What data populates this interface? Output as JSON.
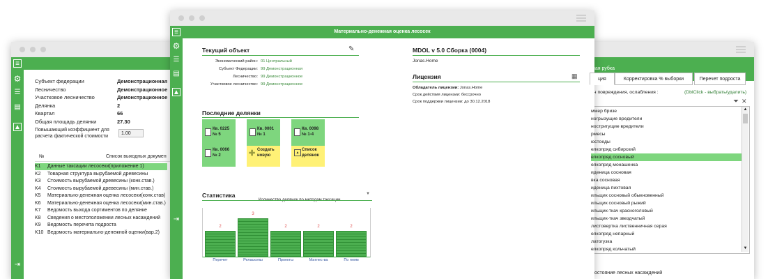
{
  "left_window": {
    "fields": [
      {
        "label": "Субъект федерации",
        "value": "Демонстрационная"
      },
      {
        "label": "Лесничество",
        "value": "Демонстрационное"
      },
      {
        "label": "Участковое лесничество",
        "value": "Демонстрационное"
      },
      {
        "label": "Делянка",
        "value": "2"
      },
      {
        "label": "Квартал",
        "value": "66"
      },
      {
        "label": "Общая площадь делянки",
        "value": "27.30"
      }
    ],
    "coef_label_1": "Повышающий коэффициент для",
    "coef_label_2": "расчета фактической стоимости",
    "coef_value": "1.00",
    "table_col_num": "№",
    "table_col_list": "Список выходных докумен",
    "docs": [
      {
        "code": "K1",
        "name": "Данные таксации лесосеки(приложение 1)"
      },
      {
        "code": "K2",
        "name": "Товарная структура вырубаемой древесины"
      },
      {
        "code": "K3",
        "name": "Стоимость вырубаемой древесины (конк.став.)"
      },
      {
        "code": "K4",
        "name": "Стоимость вырубаемой древесины (мин.став.)"
      },
      {
        "code": "K5",
        "name": "Материально-денежная оценка лесосеки(конк.став)"
      },
      {
        "code": "K6",
        "name": "Материально-денежная оценка лесосеки(мин.став.)"
      },
      {
        "code": "K7",
        "name": "Ведомость выхода сортиментов по делянке"
      },
      {
        "code": "K8",
        "name": "Сведения о местоположении лесных насаждений"
      },
      {
        "code": "K9",
        "name": "Ведомость перечета подроста"
      },
      {
        "code": "K10",
        "name": "Ведомость материально-денежной оценки(вар.2)"
      }
    ]
  },
  "center_window": {
    "title": "Материально-денежная оценка лесосек",
    "current_object": {
      "heading": "Текущий объект",
      "rows": [
        {
          "label": "Экономический район:",
          "value": "01 Центральный"
        },
        {
          "label": "Субъект Федерации:",
          "value": "99 Демонстрационная"
        },
        {
          "label": "Лесничество:",
          "value": "99 Демонстрационное"
        },
        {
          "label": "Участковое лесничество:",
          "value": "99 Демонстрационное"
        }
      ]
    },
    "version": {
      "heading": "MDOL v 5.0 Сборка (0004)",
      "owner": "Jonas.Home"
    },
    "license": {
      "heading": "Лицензия",
      "owner_label": "Обладатель лицензии:",
      "owner_value": "Jonas.Home",
      "term": "Срок действия лицензии: бессрочно",
      "support": "Срок поддержки лицензии: до 30.12.2018"
    },
    "recent": {
      "heading": "Последние делянки",
      "tiles": [
        {
          "line1": "Кв. 0225",
          "line2": "№ 5"
        },
        {
          "line1": "Кв. 0001",
          "line2": "№ 1"
        },
        {
          "line1": "Кв. 0098",
          "line2": "№ 1-4"
        },
        {
          "line1": "Кв. 0066",
          "line2": "№ 2"
        }
      ],
      "create_1": "Создать",
      "create_2": "новую",
      "list_1": "Список",
      "list_2": "делянок"
    },
    "stats": {
      "heading": "Статистика",
      "dropdown": "Количество делянок по методам таксации"
    }
  },
  "chart_data": {
    "type": "bar",
    "categories": [
      "Перечет",
      "Реласкопы",
      "Проекты",
      "Матлес-ва",
      "По пням"
    ],
    "values": [
      2,
      3,
      2,
      2,
      2
    ],
    "title": "",
    "xlabel": "",
    "ylabel": "",
    "ylim": [
      0,
      3
    ]
  },
  "right_window": {
    "title": "ная рубка",
    "tabs": [
      "ция",
      "Корректировка % выборки",
      "Перечет подроста"
    ],
    "filter_label": "ин повреждения, ослабления :",
    "filter_hint": "(DblClick - выбрать/удалить)",
    "items": [
      "ммер бризе",
      "ногрызущие вредители",
      "ностригущие вредители",
      "рмесы",
      "юстоеды",
      "елкопряд сибирский",
      "елкопряд сосновый",
      "елкопряд монашенка",
      "иденица сосновая",
      "вка сосновая",
      "иденица пихтовая",
      "ильщик сосновый обыкновенный",
      "ильщик сосновый рыжий",
      "ильщик-ткач красноголовый",
      "ильщик-ткач звездчатый",
      "листовертка лиственничная серая",
      "елкопряд непарный",
      "латогузка",
      "елкопряд кольчатый"
    ],
    "bottom_text": "Состояние лесных насаждений"
  }
}
